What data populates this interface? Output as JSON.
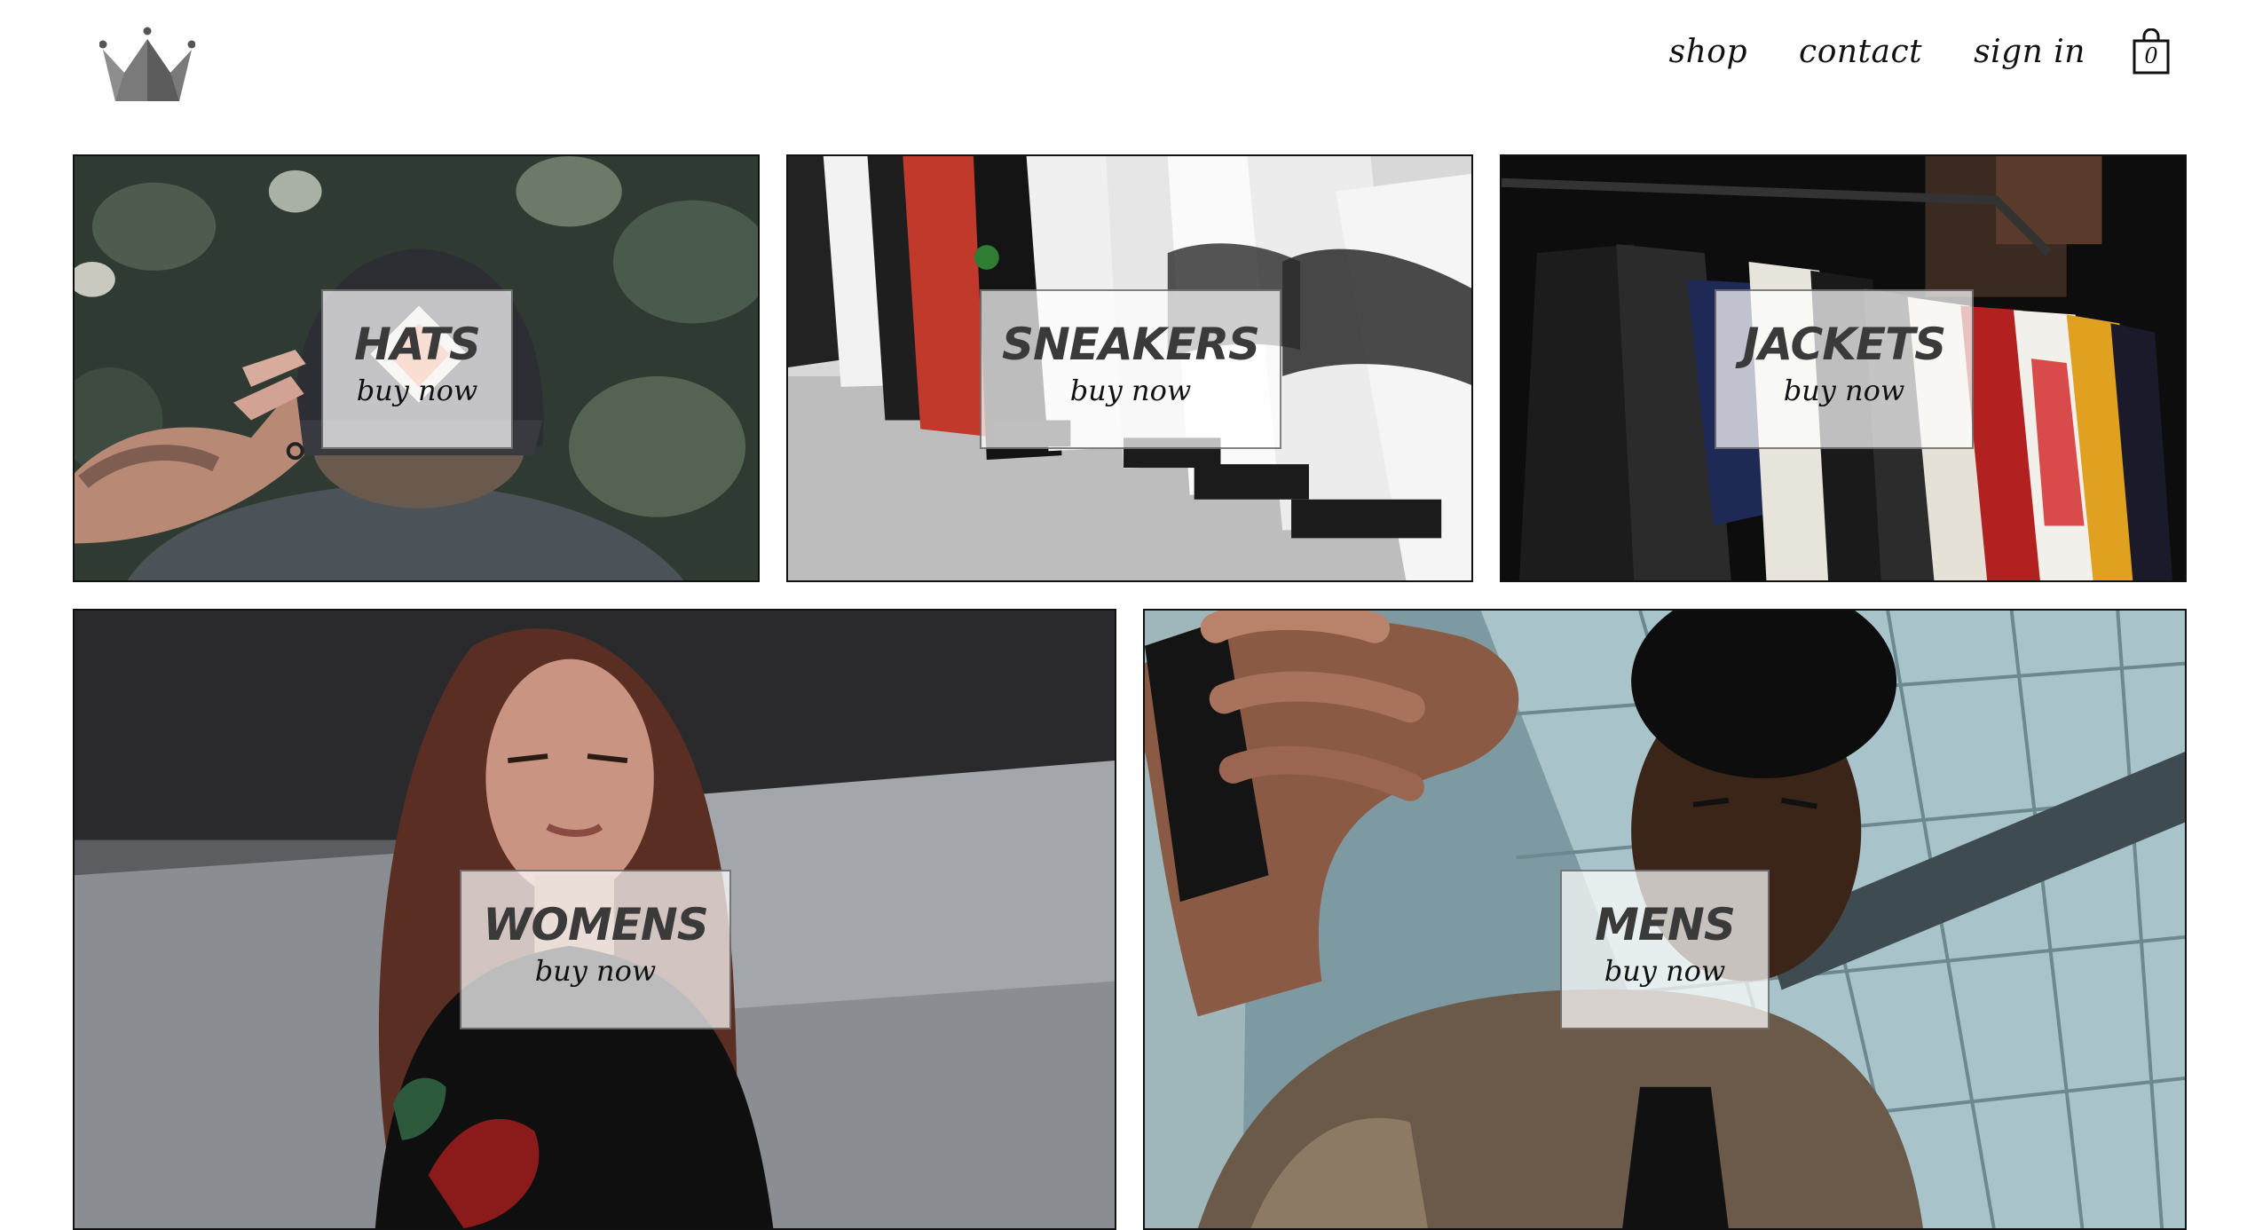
{
  "brand": {
    "logo_icon": "crown-icon"
  },
  "nav": {
    "shop": "shop",
    "contact": "contact",
    "sign_in": "sign in",
    "cart_icon": "shopping-bag-icon",
    "cart_count": "0"
  },
  "categories": [
    {
      "title": "HATS",
      "cta": "buy now"
    },
    {
      "title": "SNEAKERS",
      "cta": "buy now"
    },
    {
      "title": "JACKETS",
      "cta": "buy now"
    },
    {
      "title": "WOMENS",
      "cta": "buy now"
    },
    {
      "title": "MENS",
      "cta": "buy now"
    }
  ],
  "colors": {
    "text": "#111111",
    "label_title": "#3a3a3a",
    "label_bg": "rgba(255,255,255,0.72)",
    "border": "#111111"
  }
}
